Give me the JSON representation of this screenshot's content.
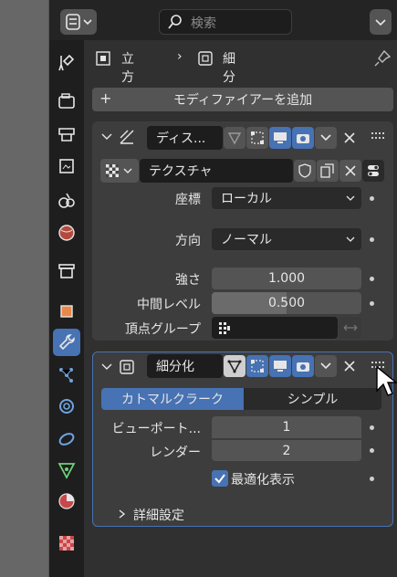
{
  "search": {
    "placeholder": "検索"
  },
  "breadcrumb": {
    "object": "立方体",
    "modifier": "細分化"
  },
  "add_modifier_label": "モディファイアーを追加",
  "displace": {
    "name": "ディス...",
    "texture_label": "テクスチャ",
    "fields": [
      {
        "label": "座標",
        "value": "ローカル"
      },
      {
        "label": "方向",
        "value": "ノーマル"
      },
      {
        "label": "強さ",
        "value": "1.000"
      },
      {
        "label": "中間レベル",
        "value": "0.500"
      },
      {
        "label": "頂点グループ",
        "value": ""
      }
    ],
    "midlevel_fraction": 0.5
  },
  "subdiv": {
    "name": "細分化",
    "tab_catmull": "カトマルクラーク",
    "tab_simple": "シンプル",
    "viewport_label": "ビューポート...",
    "viewport_value": "1",
    "render_label": "レンダー",
    "render_value": "2",
    "optimal_label": "最適化表示",
    "advanced_label": "詳細設定"
  },
  "colors": {
    "accent": "#4772b3",
    "panel": "#3d3d3d",
    "field": "#545454",
    "dark": "#1d1d1d"
  }
}
